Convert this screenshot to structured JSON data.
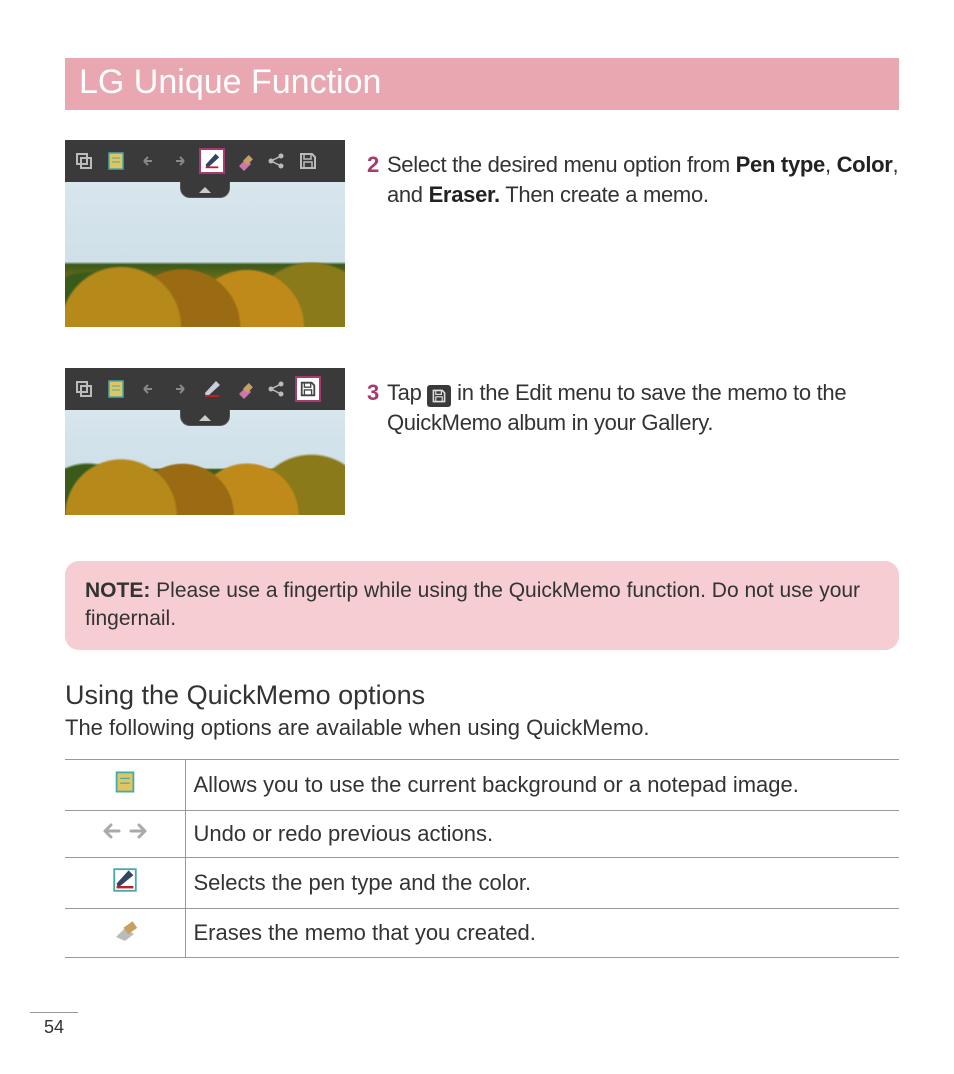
{
  "chapter_title": "LG Unique Function",
  "steps": [
    {
      "num": "2",
      "parts": [
        {
          "t": "Select the desired menu option from "
        },
        {
          "t": "Pen type",
          "b": true
        },
        {
          "t": ", "
        },
        {
          "t": "Color",
          "b": true
        },
        {
          "t": ", and "
        },
        {
          "t": "Eraser.",
          "b": true
        },
        {
          "t": " Then create a memo."
        }
      ]
    },
    {
      "num": "3",
      "parts_before": "Tap ",
      "parts_after": " in the Edit menu to save the memo to the QuickMemo album in your Gallery."
    }
  ],
  "note": {
    "label": "NOTE:",
    "text": " Please use a fingertip while using the QuickMemo function. Do not use your fingernail."
  },
  "subheading": "Using the QuickMemo options",
  "options_intro": "The following options are available when using QuickMemo.",
  "options": [
    {
      "icon": "notepad-icon",
      "desc": "Allows you to use the current background or a notepad image."
    },
    {
      "icon": "undo-redo-icon",
      "desc": "Undo or redo previous actions."
    },
    {
      "icon": "pen-icon",
      "desc": "Selects the pen type and the color."
    },
    {
      "icon": "eraser-icon",
      "desc": "Erases the memo that you created."
    }
  ],
  "page_number": "54"
}
